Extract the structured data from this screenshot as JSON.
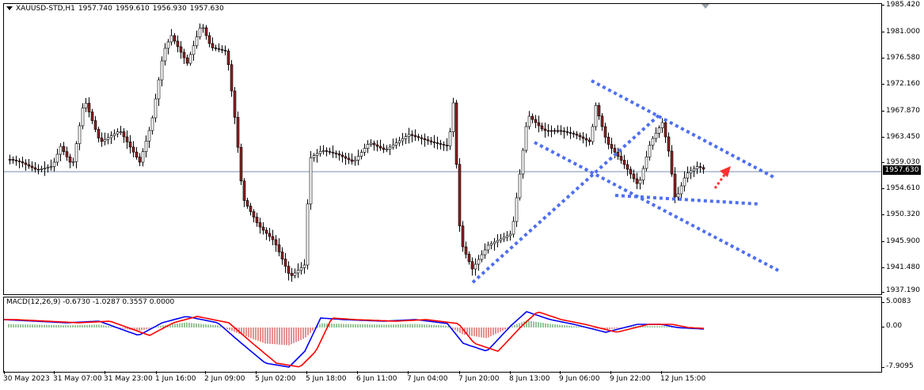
{
  "header": {
    "symbol_tf": "XAUUSD-STD,H1",
    "open": "1957.740",
    "high": "1959.610",
    "low": "1956.930",
    "close": "1957.630"
  },
  "price_axis": {
    "labels": [
      "1985.420",
      "1981.000",
      "1976.580",
      "1972.160",
      "1967.870",
      "1963.450",
      "1959.030",
      "1954.610",
      "1950.320",
      "1945.900",
      "1941.480",
      "1937.190"
    ],
    "current_price": "1957.630"
  },
  "macd": {
    "label": "MACD(12,26,9) -0.6730 -1.0287 0.3557 0.0000",
    "axis_labels": [
      "5.0083",
      "0.00",
      "-7.9095"
    ]
  },
  "time_axis": {
    "labels": [
      "30 May 2023",
      "31 May 07:00",
      "31 May 23:00",
      "1 Jun 16:00",
      "2 Jun 09:00",
      "5 Jun 02:00",
      "5 Jun 18:00",
      "6 Jun 11:00",
      "7 Jun 04:00",
      "7 Jun 20:00",
      "8 Jun 13:00",
      "9 Jun 06:00",
      "9 Jun 22:00",
      "12 Jun 15:00"
    ]
  },
  "colors": {
    "candle_fill": "#8b2323",
    "line_color": "#5a7fb0",
    "trend_line": "#4f6ff0",
    "arrow": "#ff3030",
    "macd_main": "#0000ff",
    "macd_signal": "#ff0000",
    "hist_up": "#2e8b2e",
    "hist_down": "#cc2222"
  }
}
